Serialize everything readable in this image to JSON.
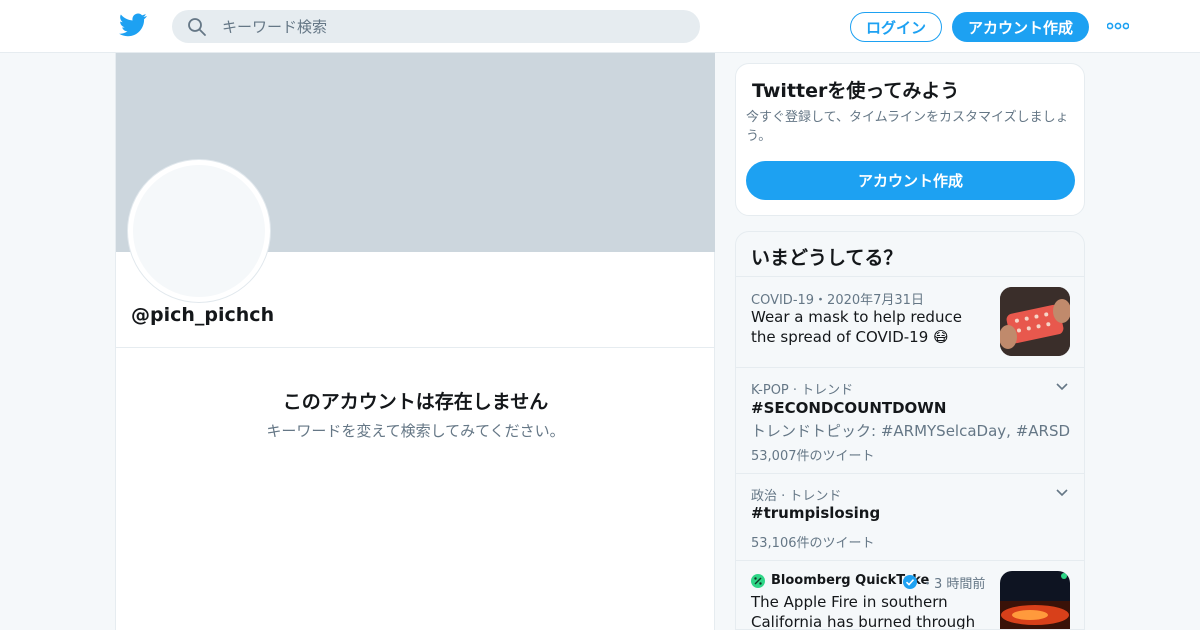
{
  "header": {
    "search_placeholder": "キーワード検索",
    "login_label": "ログイン",
    "signup_label": "アカウント作成"
  },
  "profile": {
    "handle": "@pich_pichch",
    "empty_title": "このアカウントは存在しません",
    "empty_sub": "キーワードを変えて検索してみてください。"
  },
  "signup_card": {
    "title": "Twitterを使ってみよう",
    "desc": "今すぐ登録して、タイムラインをカスタマイズしましょう。",
    "cta": "アカウント作成"
  },
  "trends": {
    "title": "いまどうしてる？",
    "items": [
      {
        "meta": "COVID-19・2020年7月31日",
        "text": "Wear a mask to help reduce the spread of COVID-19 😷"
      },
      {
        "meta": "K-POP · トレンド",
        "text": "#SECONDCOUNTDOWN",
        "sub": "トレンドトピック: #ARMYSelcaDay, #ARSD",
        "count": "53,007件のツイート"
      },
      {
        "meta": "政治 · トレンド",
        "text": "#trumpislosing",
        "count": "53,106件のツイート"
      },
      {
        "meta_source": "Bloomberg QuickTake",
        "meta_time": "・3 時間前",
        "text": "The Apple Fire in southern California has burned through"
      }
    ]
  },
  "colors": {
    "accent": "#1da1f2",
    "banner": "#ccd6dd",
    "muted_text": "#657786",
    "primary_text": "#14171a"
  }
}
